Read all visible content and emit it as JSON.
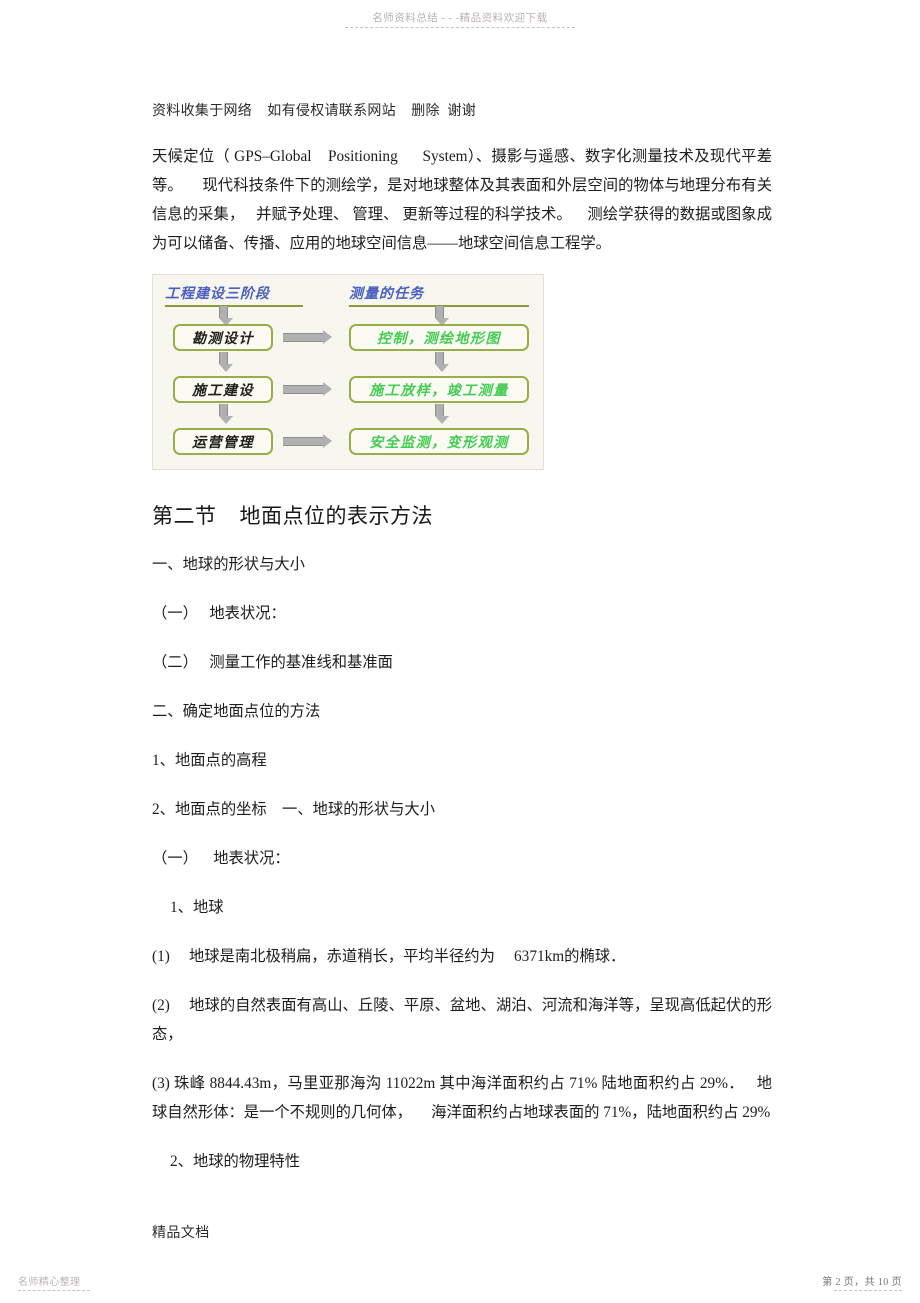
{
  "watermarks": {
    "top": "名师资料总结 - - -精品资料欢迎下载",
    "bottom_left": "名师精心整理",
    "bottom_right": "第 2 页，共 10 页"
  },
  "document": {
    "header_note": "资料收集于网络    如有侵权请联系网站    删除  谢谢",
    "paragraph": "天候定位（ GPS–Global    Positioning      System）、摄影与遥感、数字化测量技术及现代平差等。     现代科技条件下的测绘学，是对地球整体及其表面和外层空间的物体与地理分布有关信息的采集，   并赋予处理、 管理、 更新等过程的科学技术。    测绘学获得的数据或图象成为可以储备、传播、应用的地球空间信息——地球空间信息工程学。",
    "section_heading": "第二节    地面点位的表示方法",
    "lines": [
      "一、地球的形状与大小",
      "（一）   地表状况：",
      "（二）   测量工作的基准线和基准面",
      "二、确定地面点位的方法",
      "1、地面点的高程",
      "2、地面点的坐标    一、地球的形状与大小",
      "（一）    地表状况：",
      "1、地球",
      "(1)     地球是南北极稍扁，赤道稍长，平均半径约为     6371km的椭球．",
      "(2)     地球的自然表面有高山、丘陵、平原、盆地、湖泊、河流和海洋等，呈现高低起伏的形态，",
      "(3) 珠峰 8844.43m，马里亚那海沟 11022m 其中海洋面积约占 71% 陆地面积约占 29%．   地球自然形体：是一个不规则的几何体，     海洋面积约占地球表面的 71%，陆地面积约占 29%",
      "2、地球的物理特性"
    ],
    "footer_note": "精品文档"
  },
  "figure": {
    "title_left": "工程建设三阶段",
    "title_right": "测量的任务",
    "rows": [
      {
        "stage": "勘测设计",
        "task": "控制，测绘地形图"
      },
      {
        "stage": "施工建设",
        "task": "施工放样，竣工测量"
      },
      {
        "stage": "运营管理",
        "task": "安全监测，变形观测"
      }
    ],
    "colors": {
      "title": "#4a5fc1",
      "box_border": "#9aad4c",
      "task_text": "#44cc55",
      "stage_text": "#20201a",
      "background": "#f7f7ef",
      "arrow": "#b0b0b0"
    }
  }
}
